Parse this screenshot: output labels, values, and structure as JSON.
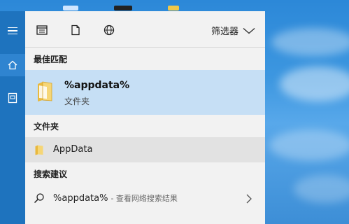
{
  "toolbar": {
    "filter_label": "筛选器"
  },
  "sections": {
    "best_match": "最佳匹配",
    "folders": "文件夹",
    "suggestions": "搜索建议"
  },
  "best_match_item": {
    "title": "%appdata%",
    "subtitle": "文件夹"
  },
  "folder_item": {
    "label": "AppData"
  },
  "suggestion_item": {
    "query": "%appdata%",
    "hint": "- 查看网络搜索结果"
  },
  "colors": {
    "rail": "#1e73be",
    "selected": "#c6dff5",
    "hover": "#e2e2e2",
    "folder": "#f2c75a"
  },
  "icons": {
    "rail": [
      "hamburger-icon",
      "home-icon",
      "document-icon"
    ],
    "toolbar": [
      "apps-icon",
      "documents-icon",
      "web-icon",
      "chevron-down-icon"
    ],
    "results": [
      "folder-icon",
      "search-icon",
      "chevron-right-icon"
    ]
  }
}
